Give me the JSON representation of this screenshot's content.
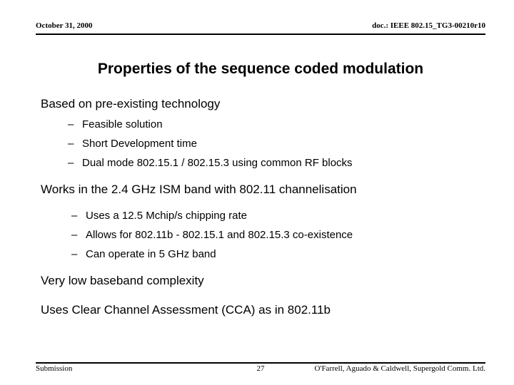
{
  "header": {
    "date": "October 31, 2000",
    "doc": "doc.: IEEE 802.15_TG3-00210r10"
  },
  "title": "Properties of the sequence coded modulation",
  "content": {
    "bullets": [
      {
        "level": 1,
        "text": "Based on pre-existing technology"
      },
      {
        "level": 2,
        "marker": "–",
        "text": "Feasible solution"
      },
      {
        "level": 2,
        "marker": "–",
        "text": "Short Development time"
      },
      {
        "level": 2,
        "marker": "–",
        "text": "Dual mode 802.15.1 / 802.15.3 using common RF blocks"
      },
      {
        "level": 1,
        "text": "Works in the 2.4 GHz ISM band with 802.11 channelisation"
      },
      {
        "level": 2,
        "marker": "–",
        "text": "Uses a 12.5 Mchip/s chipping rate"
      },
      {
        "level": 2,
        "marker": "–",
        "text": "Allows for 802.11b - 802.15.1 and 802.15.3 co-existence"
      },
      {
        "level": 2,
        "marker": "–",
        "text": "Can operate in 5 GHz band"
      },
      {
        "level": 1,
        "text": "Very low baseband complexity"
      },
      {
        "level": 1,
        "text": "Uses Clear Channel Assessment (CCA) as in 802.11b"
      }
    ]
  },
  "footer": {
    "left": "Submission",
    "page": "27",
    "right": "O'Farrell, Aguado & Caldwell, Supergold Comm. Ltd."
  },
  "colors": {
    "background": "#ffffff",
    "text": "#000000",
    "rule": "#000000"
  }
}
